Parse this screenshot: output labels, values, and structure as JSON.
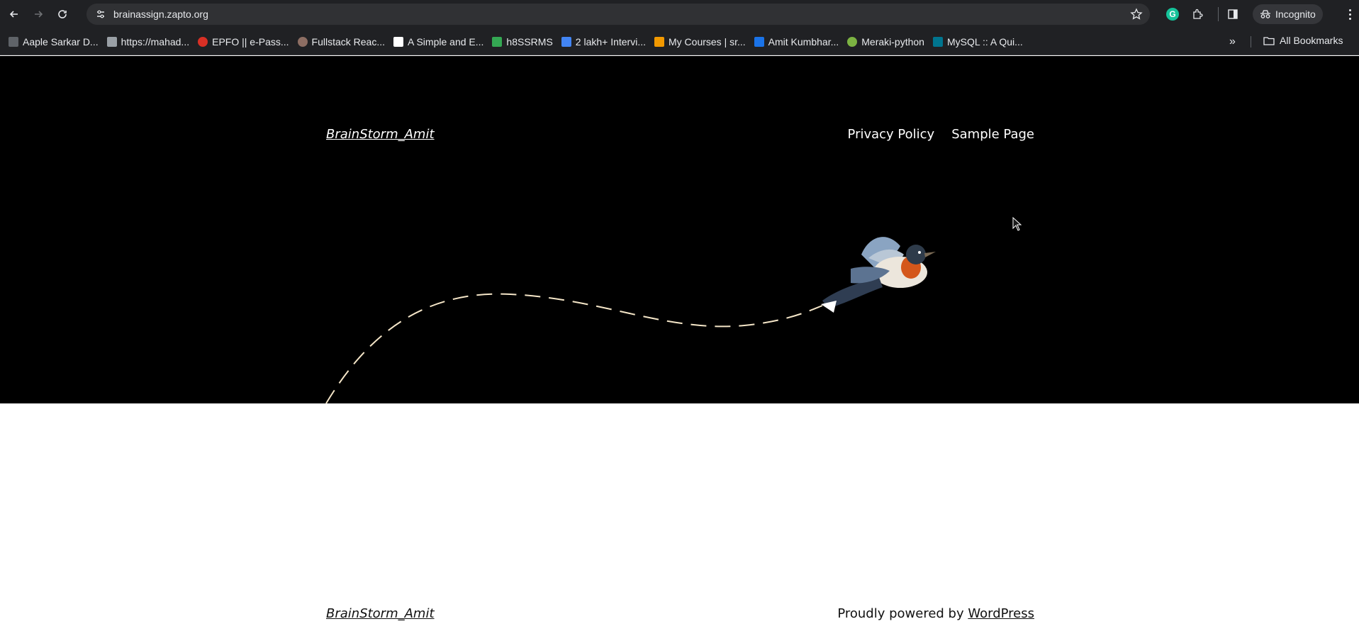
{
  "browser": {
    "url": "brainassign.zapto.org",
    "incognito_label": "Incognito",
    "grammarly_letter": "G",
    "all_bookmarks_label": "All Bookmarks",
    "more_bookmarks": "»",
    "bookmarks": [
      {
        "label": "Aaple Sarkar D...",
        "color": "#5f6368"
      },
      {
        "label": "https://mahad...",
        "color": "#9aa0a6"
      },
      {
        "label": "EPFO || e-Pass...",
        "color": "#d93025"
      },
      {
        "label": "Fullstack Reac...",
        "color": "#8d6e63"
      },
      {
        "label": "A Simple and E...",
        "color": "#ffffff"
      },
      {
        "label": "h8SSRMS",
        "color": "#34a853"
      },
      {
        "label": "2 lakh+ Intervi...",
        "color": "#4285f4"
      },
      {
        "label": "My Courses | sr...",
        "color": "#f29900"
      },
      {
        "label": "Amit Kumbhar...",
        "color": "#1a73e8"
      },
      {
        "label": "Meraki-python",
        "color": "#7cb342"
      },
      {
        "label": "MySQL :: A Qui...",
        "color": "#00758f"
      }
    ]
  },
  "site": {
    "title": "BrainStorm_Amit",
    "nav": [
      "Privacy Policy",
      "Sample Page"
    ],
    "footer_title": "BrainStorm_Amit",
    "powered_prefix": "Proudly powered by ",
    "powered_link": "WordPress"
  },
  "colors": {
    "hero_bg": "#000000",
    "path_stroke": "#f5e6c8",
    "page_bg": "#ffffff"
  }
}
